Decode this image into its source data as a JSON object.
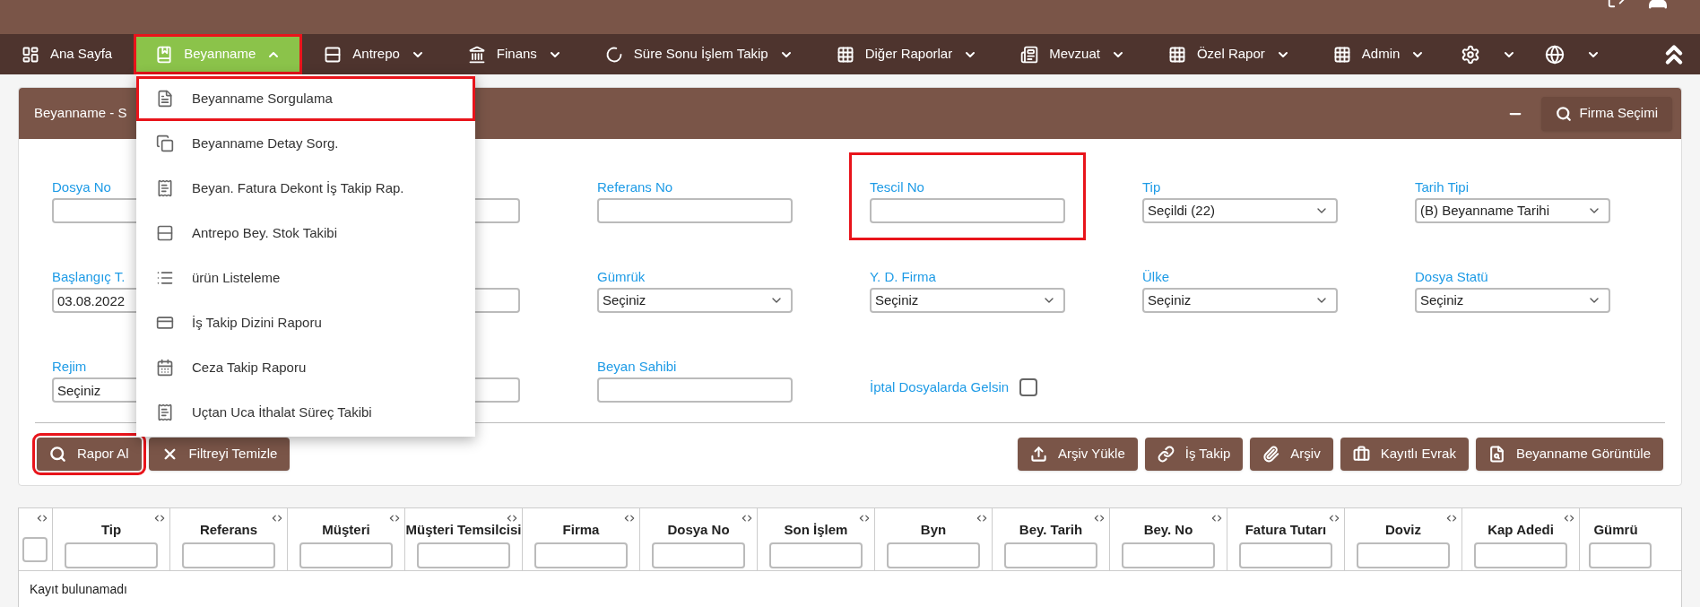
{
  "nav": [
    {
      "kind": "link",
      "label": "Ana Sayfa",
      "caret": false,
      "expanded": false
    },
    {
      "kind": "link",
      "label": "Beyanname",
      "caret": true,
      "expanded": true,
      "highlighted": true
    },
    {
      "kind": "link",
      "label": "Antrepo",
      "caret": true,
      "expanded": false
    },
    {
      "kind": "link",
      "label": "Finans",
      "caret": true,
      "expanded": false
    },
    {
      "kind": "link",
      "label": "Süre Sonu İşlem Takip",
      "caret": true,
      "expanded": false
    },
    {
      "kind": "link",
      "label": "Diğer Raporlar",
      "caret": true,
      "expanded": false
    },
    {
      "kind": "link",
      "label": "Mevzuat",
      "caret": true,
      "expanded": false
    },
    {
      "kind": "link",
      "label": "Özel Rapor",
      "caret": true,
      "expanded": false
    },
    {
      "kind": "link",
      "label": "Admin",
      "caret": true,
      "expanded": false
    },
    {
      "kind": "icon",
      "caret": true,
      "expanded": false
    },
    {
      "kind": "icon",
      "caret": true,
      "expanded": false
    }
  ],
  "dropdown": [
    {
      "label": "Beyanname Sorgulama",
      "highlighted": true
    },
    {
      "label": "Beyanname Detay Sorg.",
      "highlighted": false
    },
    {
      "label": "Beyan. Fatura Dekont İş Takip Rap.",
      "highlighted": false
    },
    {
      "label": "Antrepo Bey. Stok Takibi",
      "highlighted": false
    },
    {
      "label": "ürün Listeleme",
      "highlighted": false
    },
    {
      "label": "İş Takip Dizini Raporu",
      "highlighted": false
    },
    {
      "label": "Ceza Takip Raporu",
      "highlighted": false
    },
    {
      "label": "Uçtan Uca İthalat Süreç Takibi",
      "highlighted": false
    }
  ],
  "panel": {
    "title": "Beyanname - S",
    "firm_button": "Firma Seçimi"
  },
  "fields": [
    {
      "kind": "text",
      "label": "Dosya No"
    },
    {
      "kind": "text"
    },
    {
      "kind": "text",
      "label": "Referans No"
    },
    {
      "kind": "text",
      "label": "Tescil No",
      "highlighted": true
    },
    {
      "kind": "select",
      "label": "Tip",
      "value": "Seçildi (22)"
    },
    {
      "kind": "select",
      "label": "Tarih Tipi",
      "value": "(B) Beyanname Tarihi"
    },
    {
      "kind": "text",
      "label": "Başlangıç T.",
      "value": "03.08.2022"
    },
    {
      "kind": "text"
    },
    {
      "kind": "select",
      "label": "Gümrük",
      "value": "Seçiniz"
    },
    {
      "kind": "select",
      "label": "Y. D. Firma",
      "value": "Seçiniz"
    },
    {
      "kind": "select",
      "label": "Ülke",
      "value": "Seçiniz"
    },
    {
      "kind": "select",
      "label": "Dosya Statü",
      "value": "Seçiniz"
    },
    {
      "kind": "text",
      "label": "Rejim",
      "value": "Seçiniz"
    },
    {
      "kind": "text"
    },
    {
      "kind": "text",
      "label": "Beyan Sahibi"
    },
    {
      "kind": "checkbox",
      "label": "İptal Dosyalarda Gelsin",
      "checked": false
    }
  ],
  "left_buttons": [
    {
      "label": "Rapor Al",
      "highlighted": true
    },
    {
      "label": "Filtreyi Temizle",
      "highlighted": false
    }
  ],
  "right_buttons": [
    "Arşiv Yükle",
    "İş Takip",
    "Arşiv",
    "Kayıtlı Evrak",
    "Beyanname Görüntüle"
  ],
  "table": {
    "columns": [
      "Tip",
      "Referans",
      "Müşteri",
      "Müşteri Temsilcisi",
      "Firma",
      "Dosya No",
      "Son İşlem",
      "Byn",
      "Bey. Tarih",
      "Bey. No",
      "Fatura Tutarı",
      "Doviz",
      "Kap Adedi",
      "Gümrü"
    ],
    "empty_text": "Kayıt bulunamadı"
  }
}
